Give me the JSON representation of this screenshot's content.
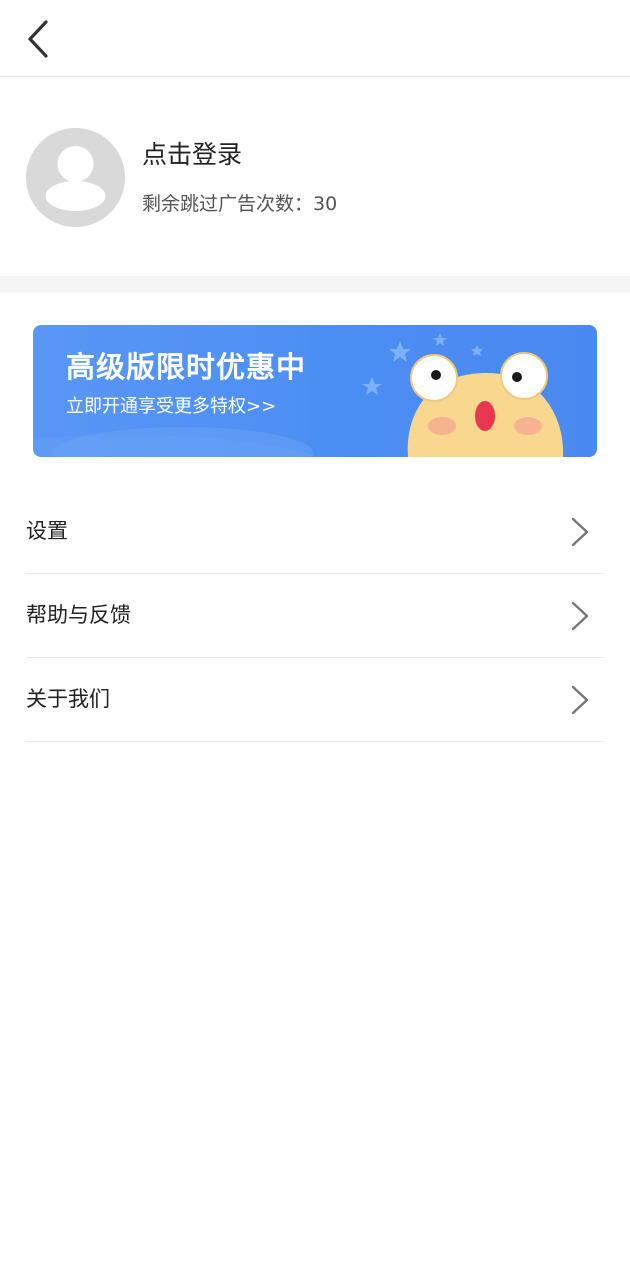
{
  "header": {
    "back_icon": "chevron-left-icon"
  },
  "profile": {
    "avatar_icon": "user-placeholder-icon",
    "login_label": "点击登录",
    "skip_ads_text": "剩余跳过广告次数：30"
  },
  "banner": {
    "title": "高级版限时优惠中",
    "subtitle": "立即开通享受更多特权>>",
    "mascot_icon": "cartoon-frog-mascot-icon",
    "background_color": "#4b8ef3"
  },
  "menu": {
    "items": [
      {
        "label": "设置",
        "icon": "chevron-right-icon"
      },
      {
        "label": "帮助与反馈",
        "icon": "chevron-right-icon"
      },
      {
        "label": "关于我们",
        "icon": "chevron-right-icon"
      }
    ]
  }
}
